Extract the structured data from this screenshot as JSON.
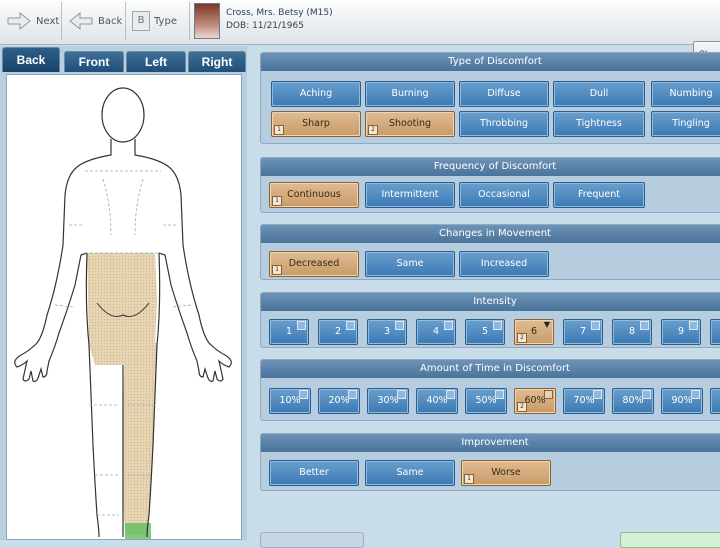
{
  "toolbar": {
    "next_label": "Next",
    "back_label": "Back",
    "type_label": "Type",
    "type_badge": "B"
  },
  "patient": {
    "name_line": "Cross, Mrs. Betsy (M15)",
    "dob_line": "DOB:  11/21/1965"
  },
  "show_label": "Show",
  "tabs": [
    "Back",
    "Front",
    "Left",
    "Right"
  ],
  "sections": {
    "type": {
      "title": "Type of Discomfort",
      "row1": [
        "Aching",
        "Burning",
        "Diffuse",
        "Dull",
        "Numbing"
      ],
      "row2": [
        "Sharp",
        "Shooting",
        "Throbbing",
        "Tightness",
        "Tingling"
      ],
      "selected": [
        "Sharp",
        "Shooting"
      ],
      "ranks": [
        "1",
        "2"
      ]
    },
    "frequency": {
      "title": "Frequency of Discomfort",
      "options": [
        "Continuous",
        "Intermittent",
        "Occasional",
        "Frequent"
      ],
      "selected": "Continuous",
      "rank": "1"
    },
    "movement": {
      "title": "Changes in Movement",
      "options": [
        "Decreased",
        "Same",
        "Increased"
      ],
      "selected": "Decreased",
      "rank": "1"
    },
    "intensity": {
      "title": "Intensity",
      "options": [
        "1",
        "2",
        "3",
        "4",
        "5",
        "6",
        "7",
        "8",
        "9"
      ],
      "selected": "6",
      "rank": "2"
    },
    "time": {
      "title": "Amount of Time in Discomfort",
      "options": [
        "10%",
        "20%",
        "30%",
        "40%",
        "50%",
        "60%",
        "70%",
        "80%",
        "90%"
      ],
      "selected": "60%",
      "rank": "2"
    },
    "improvement": {
      "title": "Improvement",
      "options": [
        "Better",
        "Same",
        "Worse"
      ],
      "selected": "Worse",
      "rank": "1"
    }
  },
  "colors": {
    "button_blue": "#4d88bf",
    "button_selected": "#d4aa7a",
    "section_header": "#5c83a9",
    "highlight_region": "#e6d4b2"
  }
}
